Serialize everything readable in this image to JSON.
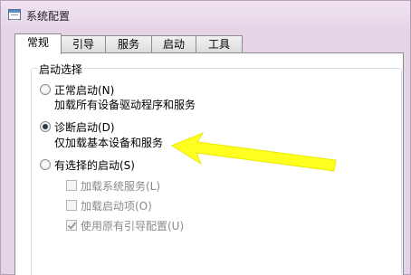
{
  "window": {
    "title": "系统配置"
  },
  "tabs": [
    {
      "label": "常规",
      "active": true
    },
    {
      "label": "引导",
      "active": false
    },
    {
      "label": "服务",
      "active": false
    },
    {
      "label": "启动",
      "active": false
    },
    {
      "label": "工具",
      "active": false
    }
  ],
  "startup": {
    "group_label": "启动选择",
    "normal": {
      "label": "正常启动(N)",
      "description": "加载所有设备驱动程序和服务",
      "selected": false
    },
    "diagnostic": {
      "label": "诊断启动(D)",
      "description": "仅加载基本设备和服务",
      "selected": true
    },
    "selective": {
      "label": "有选择的启动(S)",
      "selected": false,
      "options": [
        {
          "label": "加载系统服务(L)",
          "checked": false,
          "enabled": false
        },
        {
          "label": "加载启动项(O)",
          "checked": false,
          "enabled": false
        },
        {
          "label": "使用原有引导配置(U)",
          "checked": true,
          "enabled": false
        }
      ]
    }
  },
  "annotation": {
    "arrow_color": "#ffff20"
  }
}
